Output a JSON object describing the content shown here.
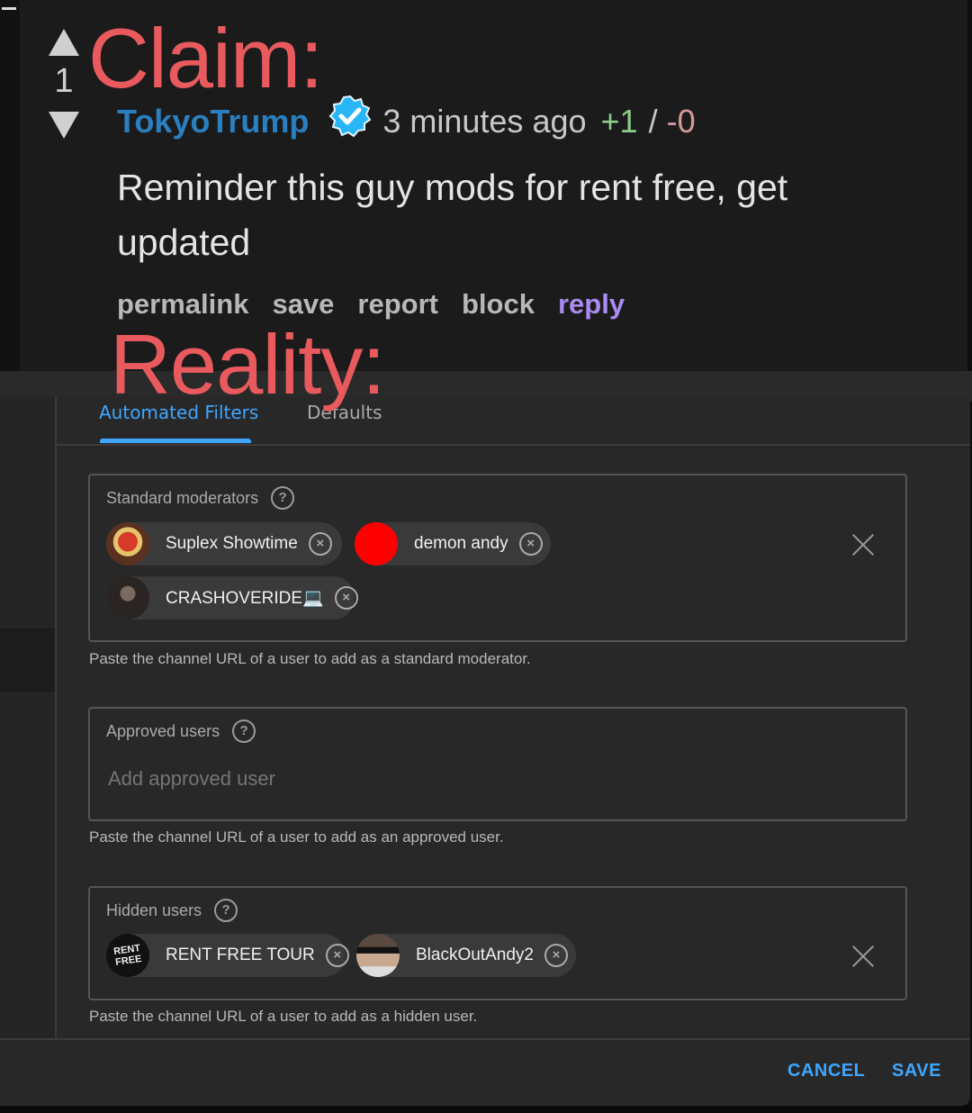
{
  "overlay": {
    "claim_label": "Claim:",
    "reality_label": "Reality:"
  },
  "comment": {
    "vote_count": "1",
    "upvote_icon": "triangle-up-icon",
    "downvote_icon": "triangle-down-icon",
    "author": "TokyoTrump",
    "verified_icon": "verified-badge-icon",
    "time_ago": "3 minutes ago",
    "upvotes": "+1",
    "separator": "/",
    "downvotes": "-0",
    "body": "Reminder this guy mods for rent free, get updated",
    "actions": [
      "permalink",
      "save",
      "report",
      "block",
      "reply"
    ],
    "colors": {
      "author": "#2a7fc0",
      "reply": "#a98bf2",
      "upvotes": "#8fce8a",
      "downvotes": "#d49a9a",
      "overlay": "#e85a5e"
    }
  },
  "dialog": {
    "tabs": [
      {
        "label": "Automated Filters",
        "active": true
      },
      {
        "label": "Defaults",
        "active": false
      }
    ],
    "standard_moderators": {
      "label": "Standard moderators",
      "help_icon": "?",
      "users": [
        {
          "name": "Suplex Showtime",
          "avatar": "wrestling-emblem-avatar"
        },
        {
          "name": "demon andy",
          "avatar": "red-circle-avatar",
          "avatar_color": "#ff0000"
        },
        {
          "name": "CRASHOVERIDE💻",
          "avatar": "photo-avatar"
        }
      ],
      "hint": "Paste the channel URL of a user to add as a standard moderator."
    },
    "approved_users": {
      "label": "Approved users",
      "help_icon": "?",
      "placeholder": "Add approved user",
      "hint": "Paste the channel URL of a user to add as an approved user."
    },
    "hidden_users": {
      "label": "Hidden users",
      "help_icon": "?",
      "users": [
        {
          "name": "RENT FREE TOUR",
          "avatar": "rent-free-logo-avatar"
        },
        {
          "name": "BlackOutAndy2",
          "avatar": "sunglasses-photo-avatar"
        }
      ],
      "hint": "Paste the channel URL of a user to add as a hidden user."
    },
    "remove_glyph": "×",
    "cancel_label": "CANCEL",
    "save_label": "SAVE",
    "accent": "#3ea6ff"
  }
}
